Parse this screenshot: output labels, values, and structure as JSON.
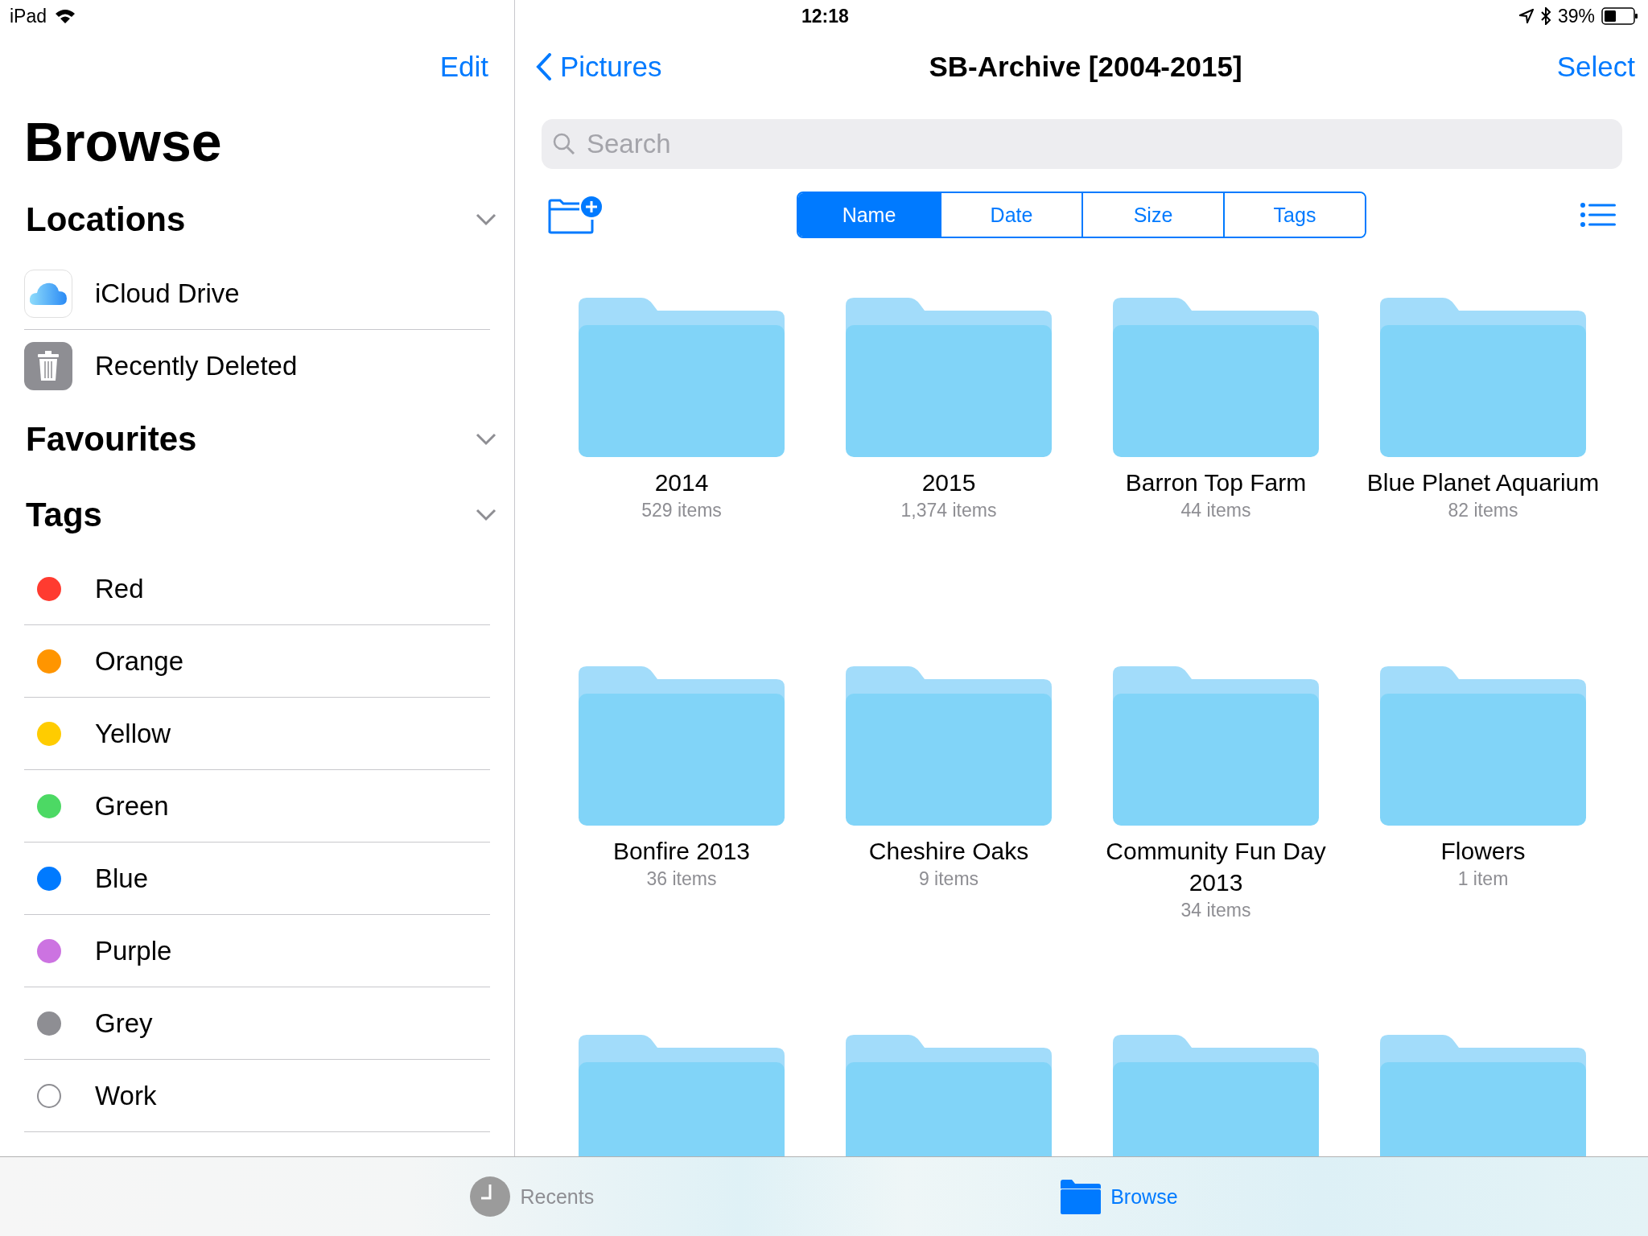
{
  "status_bar": {
    "device": "iPad",
    "time": "12:18",
    "battery": "39%"
  },
  "sidebar": {
    "edit": "Edit",
    "title": "Browse",
    "sections": [
      {
        "title": "Locations",
        "expanded": true,
        "items": [
          {
            "kind": "icloud",
            "label": "iCloud Drive"
          },
          {
            "kind": "trash",
            "label": "Recently Deleted"
          }
        ]
      },
      {
        "title": "Favourites",
        "expanded": true
      },
      {
        "title": "Tags",
        "expanded": true,
        "items": [
          {
            "kind": "dot",
            "label": "Red",
            "color": "#ff3b30"
          },
          {
            "kind": "dot",
            "label": "Orange",
            "color": "#ff9500"
          },
          {
            "kind": "dot",
            "label": "Yellow",
            "color": "#ffcc00"
          },
          {
            "kind": "dot",
            "label": "Green",
            "color": "#4cd964"
          },
          {
            "kind": "dot",
            "label": "Blue",
            "color": "#007aff"
          },
          {
            "kind": "dot",
            "label": "Purple",
            "color": "#cc73e1"
          },
          {
            "kind": "dot",
            "label": "Grey",
            "color": "#8e8e93"
          },
          {
            "kind": "outline",
            "label": "Work"
          }
        ]
      }
    ]
  },
  "nav": {
    "back": "Pictures",
    "title": "SB-Archive [2004-2015]",
    "select": "Select"
  },
  "search": {
    "placeholder": "Search"
  },
  "sort_tabs": [
    {
      "label": "Name",
      "selected": true
    },
    {
      "label": "Date",
      "selected": false
    },
    {
      "label": "Size",
      "selected": false
    },
    {
      "label": "Tags",
      "selected": false
    }
  ],
  "folders": [
    {
      "kind": "folder",
      "name": "2014",
      "count": "529 items"
    },
    {
      "kind": "folder",
      "name": "2015",
      "count": "1,374 items"
    },
    {
      "kind": "folder",
      "name": "Barron Top Farm",
      "count": "44 items"
    },
    {
      "kind": "folder",
      "name": "Blue Planet Aquarium",
      "count": "82 items"
    },
    {
      "kind": "folder",
      "name": "Bonfire 2013",
      "count": "36 items"
    },
    {
      "kind": "folder",
      "name": "Cheshire Oaks",
      "count": "9 items"
    },
    {
      "kind": "folder",
      "name": "Community Fun Day 2013",
      "count": "34 items"
    },
    {
      "kind": "folder",
      "name": "Flowers",
      "count": "1 item"
    },
    {
      "kind": "folder"
    },
    {
      "kind": "folder"
    },
    {
      "kind": "folder"
    },
    {
      "kind": "folder"
    }
  ],
  "tab_bar": [
    {
      "kind": "recents",
      "label": "Recents",
      "selected": false
    },
    {
      "kind": "browse",
      "label": "Browse",
      "selected": true
    }
  ]
}
